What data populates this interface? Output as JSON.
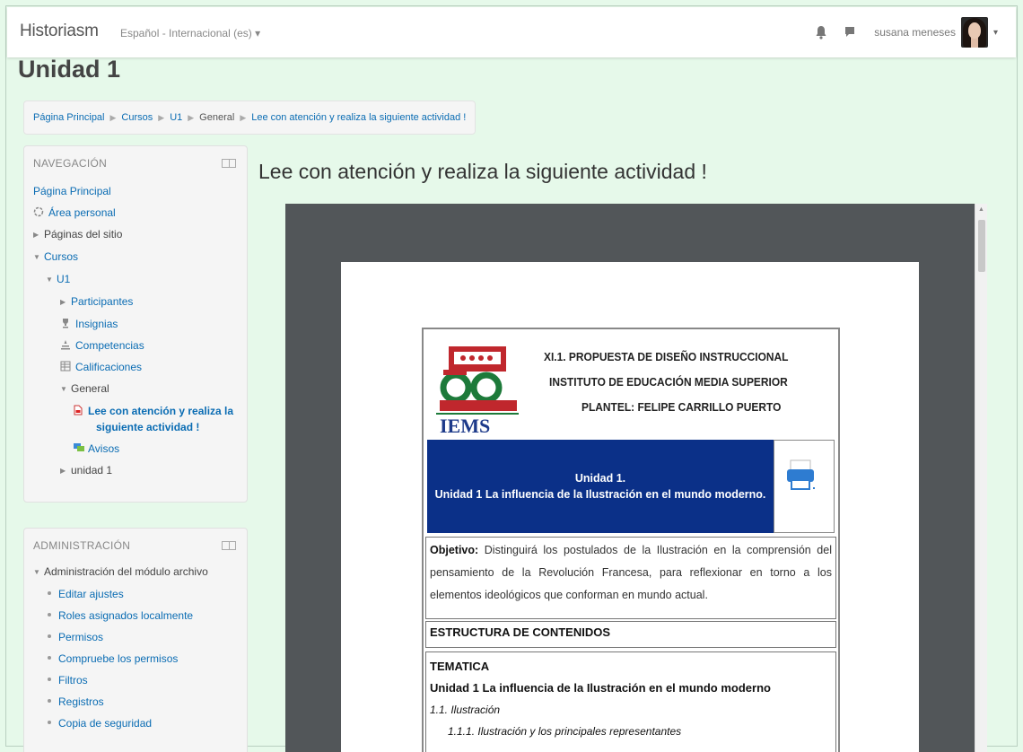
{
  "navbar": {
    "brand": "Historiasm",
    "language": "Español - Internacional (es) ▾",
    "user_name": "susana meneses",
    "icons": [
      "notification-bell-icon",
      "messages-icon"
    ]
  },
  "page_title": "Unidad 1",
  "breadcrumb": [
    "Página Principal",
    "Cursos",
    "U1",
    "General",
    "Lee con atención y realiza la siguiente actividad !"
  ],
  "navigation_block": {
    "title": "NAVEGACIÓN",
    "items": [
      "Página Principal",
      "Área personal",
      "Páginas del sitio",
      "Cursos",
      "U1",
      "Participantes",
      "Insignias",
      "Competencias",
      "Calificaciones",
      "General",
      "Lee con atención y realiza la",
      "siguiente actividad !",
      "Avisos",
      "unidad 1"
    ]
  },
  "admin_block": {
    "title": "ADMINISTRACIÓN",
    "section": "Administración del módulo archivo",
    "items": [
      "Editar ajustes",
      "Roles asignados localmente",
      "Permisos",
      "Compruebe los permisos",
      "Filtros",
      "Registros",
      "Copia de seguridad"
    ]
  },
  "main": {
    "heading": "Lee con atención y realiza la siguiente actividad !"
  },
  "document": {
    "header_lines": [
      "XI.1. PROPUESTA DE DISEÑO INSTRUCCIONAL",
      "INSTITUTO DE EDUCACIÓN MEDIA SUPERIOR",
      "PLANTEL: FELIPE CARRILLO PUERTO"
    ],
    "logo_text": "IEMS",
    "unit_line1": "Unidad 1.",
    "unit_line2": "Unidad 1 La influencia de la Ilustración en el mundo moderno.",
    "objetivo_label": "Objetivo:",
    "objetivo_text": "Distinguirá los postulados de la Ilustración en la comprensión del pensamiento de la Revolución Francesa, para reflexionar en torno a los elementos ideológicos que conforman en mundo actual.",
    "estructura": "ESTRUCTURA DE CONTENIDOS",
    "tematica": "TEMATICA",
    "tematica_unit": "Unidad 1 La influencia de la Ilustración en el mundo moderno",
    "sub1": "1.1. Ilustración",
    "sub2": "1.1.1. Ilustración y los principales representantes"
  },
  "colors": {
    "page_bg": "#e6f9ea",
    "link": "#0a6cb3",
    "unit_box": "#0b3088",
    "viewer_bg": "#525659",
    "logo_red": "#c0272d",
    "logo_green": "#1d7a3a"
  }
}
